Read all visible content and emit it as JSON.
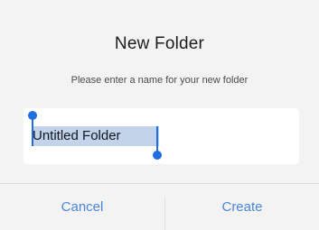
{
  "dialog": {
    "title": "New Folder",
    "message": "Please enter a name for your new folder",
    "input_value": "Untitled Folder",
    "cancel_label": "Cancel",
    "create_label": "Create"
  },
  "colors": {
    "accent": "#4a86d8",
    "selection_handle": "#1e6ee0",
    "selection_highlight": "#c3d3ea",
    "background": "#f3f3f3"
  }
}
